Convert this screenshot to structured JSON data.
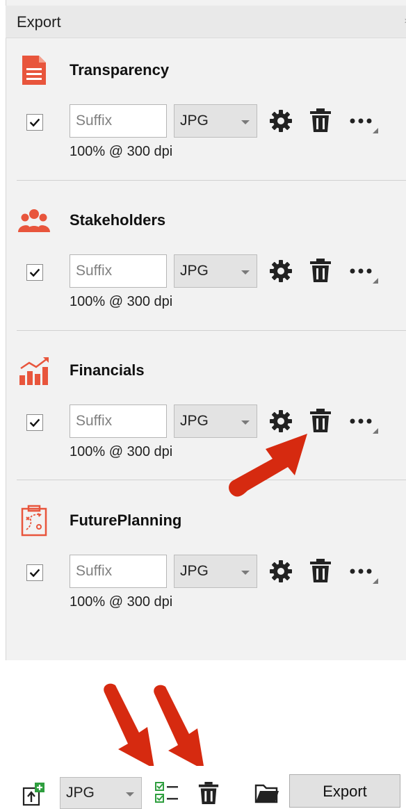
{
  "panel": {
    "title": "Export",
    "collapse_glyph": "»"
  },
  "accent_color": "#e8553c",
  "annotation_color": "#d62a10",
  "sections": [
    {
      "name": "Transparency",
      "icon": "document-icon",
      "checked": true,
      "suffix_placeholder": "Suffix",
      "format": "JPG",
      "resolution": "100% @ 300 dpi"
    },
    {
      "name": "Stakeholders",
      "icon": "people-icon",
      "checked": true,
      "suffix_placeholder": "Suffix",
      "format": "JPG",
      "resolution": "100% @ 300 dpi"
    },
    {
      "name": "Financials",
      "icon": "bar-chart-icon",
      "checked": true,
      "suffix_placeholder": "Suffix",
      "format": "JPG",
      "resolution": "100% @ 300 dpi"
    },
    {
      "name": "FuturePlanning",
      "icon": "clipboard-plan-icon",
      "checked": true,
      "suffix_placeholder": "Suffix",
      "format": "JPG",
      "resolution": "100% @ 300 dpi"
    }
  ],
  "footer": {
    "format": "JPG",
    "export_label": "Export"
  }
}
